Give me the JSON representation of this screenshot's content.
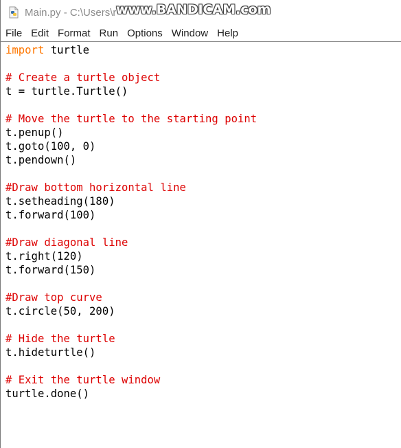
{
  "window": {
    "title": "Main.py - C:\\Users\\r",
    "watermark": "www.BANDICAM.com"
  },
  "menu": [
    {
      "id": "file",
      "label": "File"
    },
    {
      "id": "edit",
      "label": "Edit"
    },
    {
      "id": "format",
      "label": "Format"
    },
    {
      "id": "run",
      "label": "Run"
    },
    {
      "id": "options",
      "label": "Options"
    },
    {
      "id": "window",
      "label": "Window"
    },
    {
      "id": "help",
      "label": "Help"
    }
  ],
  "editor": {
    "colors": {
      "keyword": "#ff7700",
      "comment": "#dd0000",
      "text": "#000000"
    },
    "lines": [
      {
        "type": "import",
        "keyword": "import",
        "rest": " turtle"
      },
      {
        "type": "blank",
        "text": ""
      },
      {
        "type": "comment",
        "text": "# Create a turtle object"
      },
      {
        "type": "code",
        "text": "t = turtle.Turtle()"
      },
      {
        "type": "blank",
        "text": ""
      },
      {
        "type": "comment",
        "text": "# Move the turtle to the starting point"
      },
      {
        "type": "code",
        "text": "t.penup()"
      },
      {
        "type": "code",
        "text": "t.goto(100, 0)"
      },
      {
        "type": "code",
        "text": "t.pendown()"
      },
      {
        "type": "blank",
        "text": ""
      },
      {
        "type": "comment",
        "text": "#Draw bottom horizontal line"
      },
      {
        "type": "code",
        "text": "t.setheading(180)"
      },
      {
        "type": "code",
        "text": "t.forward(100)"
      },
      {
        "type": "blank",
        "text": ""
      },
      {
        "type": "comment",
        "text": "#Draw diagonal line"
      },
      {
        "type": "code",
        "text": "t.right(120)"
      },
      {
        "type": "code",
        "text": "t.forward(150)"
      },
      {
        "type": "blank",
        "text": ""
      },
      {
        "type": "comment",
        "text": "#Draw top curve"
      },
      {
        "type": "code",
        "text": "t.circle(50, 200)"
      },
      {
        "type": "blank",
        "text": ""
      },
      {
        "type": "comment",
        "text": "# Hide the turtle"
      },
      {
        "type": "code",
        "text": "t.hideturtle()"
      },
      {
        "type": "blank",
        "text": ""
      },
      {
        "type": "comment",
        "text": "# Exit the turtle window"
      },
      {
        "type": "code",
        "text": "turtle.done()"
      }
    ]
  }
}
